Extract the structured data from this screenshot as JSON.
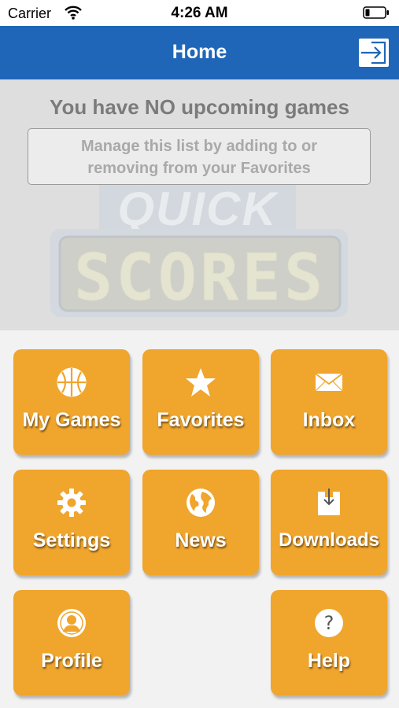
{
  "status_bar": {
    "carrier": "Carrier",
    "time": "4:26 AM"
  },
  "nav": {
    "title": "Home"
  },
  "upcoming": {
    "message": "You have NO upcoming games",
    "hint_line1": "Manage this list by adding to or",
    "hint_line2": "removing from your Favorites"
  },
  "watermark": {
    "line1": "QUICK",
    "line2": "SCORES"
  },
  "tiles": [
    {
      "label": "My Games",
      "icon": "basketball-icon"
    },
    {
      "label": "Favorites",
      "icon": "star-icon"
    },
    {
      "label": "Inbox",
      "icon": "envelope-icon"
    },
    {
      "label": "Settings",
      "icon": "gear-icon"
    },
    {
      "label": "News",
      "icon": "globe-icon"
    },
    {
      "label": "Downloads",
      "icon": "download-icon"
    },
    {
      "label": "Profile",
      "icon": "person-icon"
    },
    {
      "label": "Help",
      "icon": "question-icon"
    }
  ],
  "colors": {
    "nav_blue": "#2066b8",
    "tile_orange": "#f0a52d",
    "panel_gray": "#dedede",
    "background": "#f2f2f2"
  }
}
